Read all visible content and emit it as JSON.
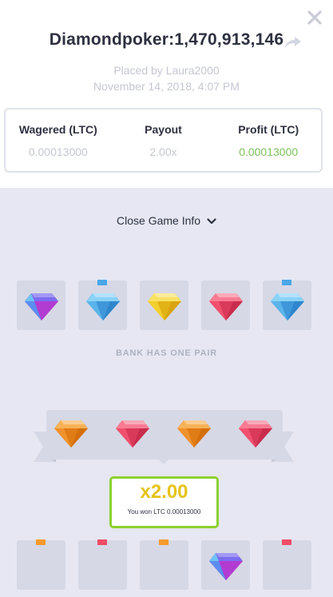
{
  "header": {
    "title": "Diamondpoker:1,470,913,146",
    "placed_by": "Placed by Laura2000",
    "date": "November 14, 2018, 4:07 PM"
  },
  "stats": [
    {
      "label": "Wagered (LTC)",
      "value": "0.00013000"
    },
    {
      "label": "Payout",
      "value": "2.00x"
    },
    {
      "label": "Profit (LTC)",
      "value": "0.00013000"
    }
  ],
  "toggle_label": "Close Game Info",
  "bank_label": "BANK HAS ONE PAIR",
  "win": {
    "multiplier": "x2.00",
    "text": "You won LTC 0.00013000"
  },
  "colors": {
    "profit": "#7cc15a",
    "win_border": "#8dd12f",
    "multiplier": "#e6c31a",
    "gem_blue": "#5ab4ea",
    "gem_yellow": "#f3cf2c",
    "gem_red": "#f0506e",
    "gem_orange": "#f0922c",
    "marker_blue": "#49a7e8",
    "marker_orange": "#f59a2c",
    "marker_red": "#ef4b66"
  },
  "bank_row": [
    "purple-gem",
    "blue-gem",
    "yellow-gem",
    "red-gem",
    "blue-gem"
  ],
  "result_row": [
    "orange-gem",
    "red-gem",
    "orange-gem",
    "red-gem"
  ],
  "player_row": [
    "empty",
    "empty",
    "empty",
    "purple-gem",
    "empty"
  ]
}
